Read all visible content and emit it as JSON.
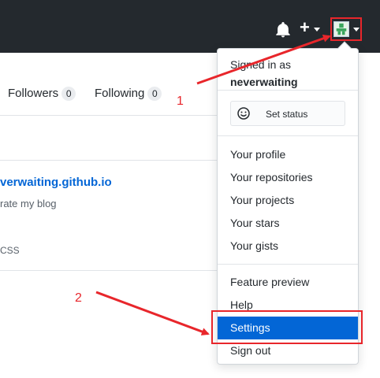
{
  "header": {
    "icons": {
      "bell": "bell-icon",
      "plus": "plus-icon",
      "avatar": "user-avatar"
    },
    "plus_symbol": "+"
  },
  "profile": {
    "tabs": [
      {
        "label": "Followers",
        "count": "0"
      },
      {
        "label": "Following",
        "count": "0"
      }
    ],
    "repo": {
      "name": "verwaiting.github.io",
      "description": "rate my blog",
      "language": "CSS"
    }
  },
  "dropdown": {
    "signed_in_label": "Signed in as",
    "username": "neverwaiting",
    "set_status_label": "Set status",
    "items_group1": [
      "Your profile",
      "Your repositories",
      "Your projects",
      "Your stars",
      "Your gists"
    ],
    "items_group2": [
      "Feature preview",
      "Help",
      "Settings",
      "Sign out"
    ],
    "active_item": "Settings"
  },
  "annotations": {
    "step1": "1",
    "step2": "2"
  },
  "colors": {
    "header_bg": "#24292e",
    "link": "#0366d6",
    "active_item_bg": "#0366d6",
    "annotation_red": "#e8262b"
  }
}
